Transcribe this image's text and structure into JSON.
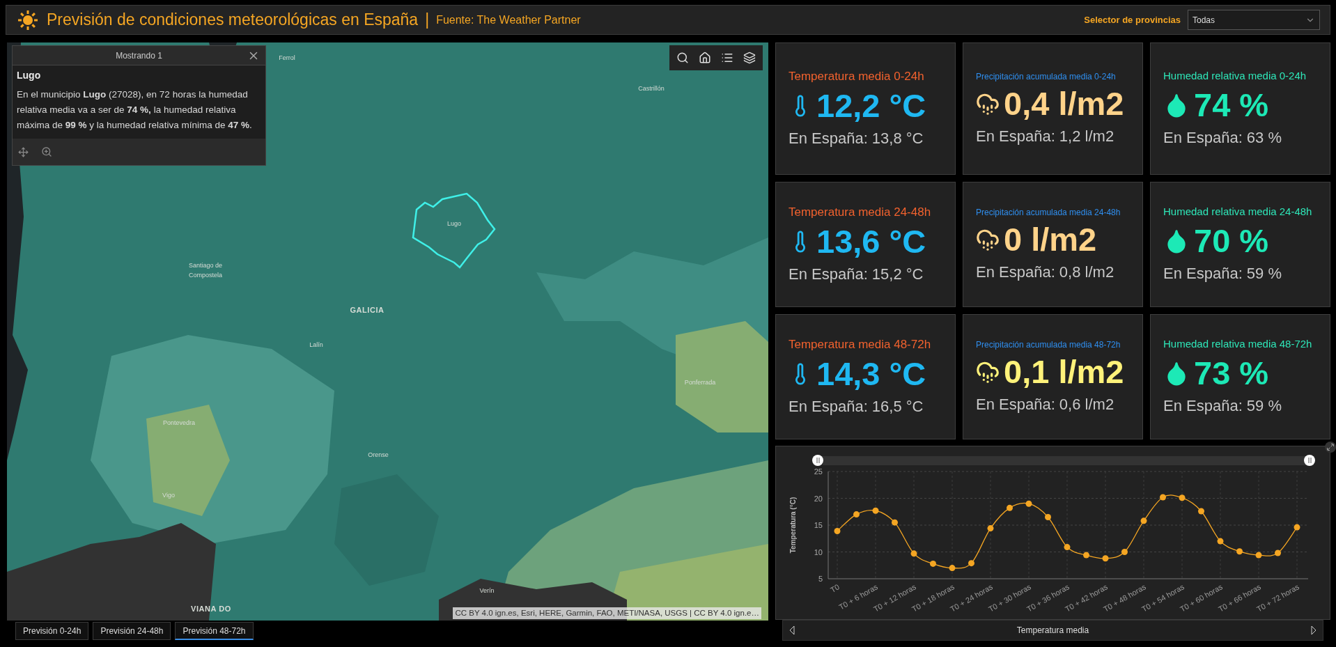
{
  "header": {
    "title": "Previsión de condiciones meteorológicas en España",
    "separator": "|",
    "source": "Fuente: The Weather Partner",
    "selector_label": "Selector de provincias",
    "selector_value": "Todas"
  },
  "map": {
    "labels": [
      {
        "text": "Ferrol",
        "kind": "city"
      },
      {
        "text": "Castrillón",
        "kind": "city"
      },
      {
        "text": "Lugo",
        "kind": "city"
      },
      {
        "text": "Santiago de Compostela",
        "kind": "city"
      },
      {
        "text": "GALICIA",
        "kind": "region"
      },
      {
        "text": "Lalín",
        "kind": "city"
      },
      {
        "text": "Ponferrada",
        "kind": "city"
      },
      {
        "text": "Pontevedra",
        "kind": "city"
      },
      {
        "text": "Orense",
        "kind": "city"
      },
      {
        "text": "Vigo",
        "kind": "city"
      },
      {
        "text": "Verín",
        "kind": "city"
      },
      {
        "text": "VIANA DO",
        "kind": "region"
      }
    ],
    "attribution": "CC BY 4.0 ign.es, Esri, HERE, Garmin, FAO, METI/NASA, USGS | CC BY 4.0 ign.e…",
    "popup": {
      "header": "Mostrando 1",
      "title": "Lugo",
      "text": "En el municipio **Lugo** (27028), en 72 horas la humedad relativa media va a ser de **74 %,** la humedad relativa máxima de **99 %** y la humedad relativa mínima de **47 %**."
    }
  },
  "tabs": [
    {
      "label": "Previsión 0-24h",
      "selected": false
    },
    {
      "label": "Previsión 24-48h",
      "selected": false
    },
    {
      "label": "Previsión 48-72h",
      "selected": true
    }
  ],
  "cards": [
    {
      "kind": "temperature",
      "title": "Temperatura media 0-24h",
      "value": "12,2 °C",
      "spain": "En España: 13,8 °C",
      "color": "#1fb8f2"
    },
    {
      "kind": "precipitation",
      "title": "Precipitación acumulada media 0-24h",
      "value": "0,4 l/m2",
      "spain": "En España: 1,2 l/m2",
      "color": "#ffd38a"
    },
    {
      "kind": "humidity",
      "title": "Humedad relativa media 0-24h",
      "value": "74 %",
      "spain": "En España: 63 %",
      "color": "#1de9b6"
    },
    {
      "kind": "temperature",
      "title": "Temperatura media 24-48h",
      "value": "13,6 °C",
      "spain": "En España: 15,2 °C",
      "color": "#1fb8f2"
    },
    {
      "kind": "precipitation",
      "title": "Precipitación acumulada media 24-48h",
      "value": "0 l/m2",
      "spain": "En España: 0,8 l/m2",
      "color": "#ffd38a"
    },
    {
      "kind": "humidity",
      "title": "Humedad relativa media 24-48h",
      "value": "70 %",
      "spain": "En España: 59 %",
      "color": "#1de9b6"
    },
    {
      "kind": "temperature",
      "title": "Temperatura media 48-72h",
      "value": "14,3 °C",
      "spain": "En España: 16,5 °C",
      "color": "#1fb8f2"
    },
    {
      "kind": "precipitation",
      "title": "Precipitación acumulada media 48-72h",
      "value": "0,1 l/m2",
      "spain": "En España: 0,6 l/m2",
      "color": "#fff27a"
    },
    {
      "kind": "humidity",
      "title": "Humedad relativa media 48-72h",
      "value": "73 %",
      "spain": "En España: 59 %",
      "color": "#1de9b6"
    }
  ],
  "chart": {
    "chart_data": {
      "type": "line",
      "grid": true,
      "ylabel": "Temperatura (°C)",
      "ylim": [
        5,
        25
      ],
      "yticks": [
        5,
        10,
        15,
        20,
        25
      ],
      "categories": [
        "T0",
        null,
        "T0 + 6 horas",
        null,
        "T0 + 12 horas",
        null,
        "T0 + 18 horas",
        null,
        "T0 + 24 horas",
        null,
        "T0 + 30 horas",
        null,
        "T0 + 36 horas",
        null,
        "T0 + 42 horas",
        null,
        "T0 + 48 horas",
        null,
        "T0 + 54 horas",
        null,
        "T0 + 60 horas",
        null,
        "T0 + 66 horas",
        null,
        "T0 + 72 horas"
      ],
      "series": [
        {
          "name": "Temperatura media",
          "color": "#f5a623",
          "marker": true,
          "values": [
            13.9,
            17.0,
            17.7,
            15.5,
            9.7,
            7.8,
            7.0,
            7.9,
            14.4,
            18.2,
            19.0,
            16.5,
            10.9,
            9.4,
            8.8,
            10.0,
            15.8,
            20.2,
            20.1,
            17.6,
            12.0,
            10.1,
            9.4,
            9.8,
            14.6
          ]
        }
      ]
    }
  }
}
